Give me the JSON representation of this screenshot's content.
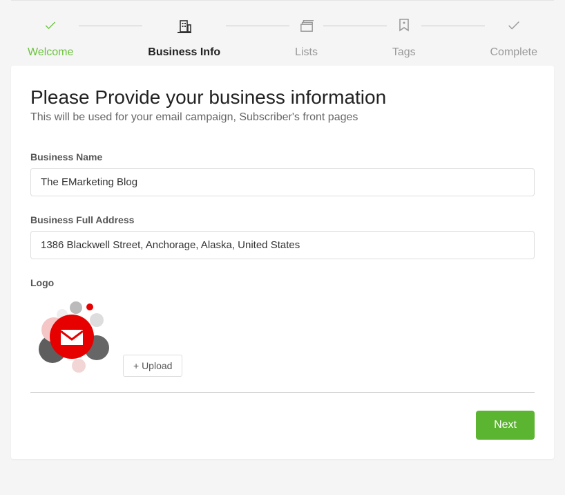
{
  "stepper": {
    "steps": [
      {
        "label": "Welcome",
        "icon": "check",
        "state": "completed"
      },
      {
        "label": "Business Info",
        "icon": "building",
        "state": "active"
      },
      {
        "label": "Lists",
        "icon": "stack",
        "state": "pending"
      },
      {
        "label": "Tags",
        "icon": "tag",
        "state": "pending"
      },
      {
        "label": "Complete",
        "icon": "check",
        "state": "pending"
      }
    ]
  },
  "heading": "Please Provide your business information",
  "subheading": "This will be used for your email campaign, Subscriber's front pages",
  "fields": {
    "business_name": {
      "label": "Business Name",
      "value": "The EMarketing Blog"
    },
    "business_address": {
      "label": "Business Full Address",
      "value": "1386 Blackwell Street, Anchorage, Alaska, United States"
    },
    "logo": {
      "label": "Logo",
      "upload_button": "+ Upload"
    }
  },
  "footer": {
    "next_label": "Next"
  },
  "colors": {
    "accent_green": "#5cb531",
    "step_done": "#6bc23c"
  }
}
